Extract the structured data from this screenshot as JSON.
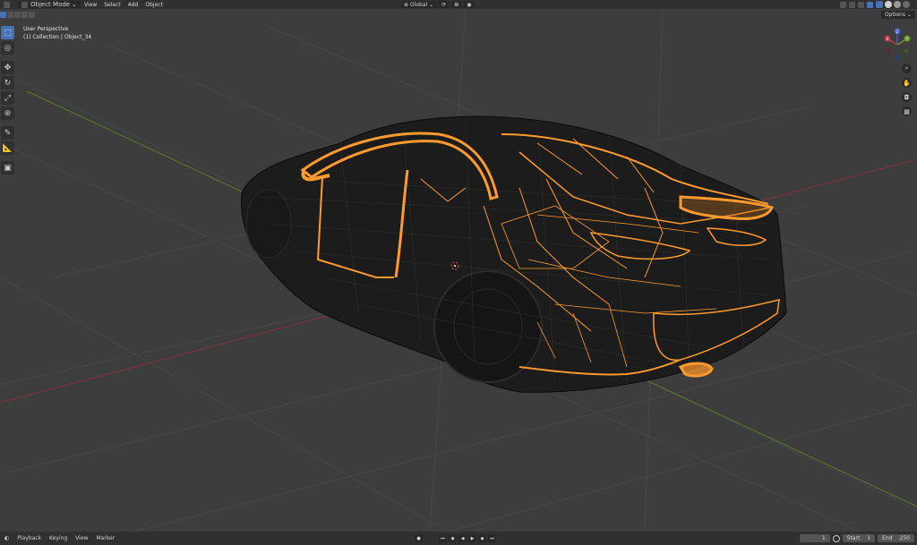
{
  "header": {
    "mode": "Object Mode",
    "menus": [
      "View",
      "Select",
      "Add",
      "Object"
    ],
    "orientation": "Global",
    "options_label": "Options"
  },
  "viewport": {
    "view_name": "User Perspective",
    "collection": "(1) Collection",
    "object": "Object_34"
  },
  "gizmo": {
    "z": "Z",
    "y": "Y",
    "x": "X"
  },
  "timeline": {
    "menus": [
      "Playback",
      "Keying",
      "View",
      "Marker"
    ],
    "current_frame": "1",
    "start_label": "Start",
    "start_value": "1",
    "end_label": "End",
    "end_value": "250"
  },
  "colors": {
    "selected_wire": "#ff9a2e",
    "x_axis": "#b0354a",
    "y_axis": "#6a9a2a",
    "accent": "#4772b3"
  },
  "icons": {
    "tools": [
      "select-box-icon",
      "cursor-icon",
      "move-icon",
      "rotate-icon",
      "scale-icon",
      "transform-icon",
      "annotate-icon",
      "measure-icon",
      "add-cube-icon"
    ],
    "nav": [
      "zoom-icon",
      "pan-icon",
      "camera-icon",
      "grid-icon"
    ]
  }
}
